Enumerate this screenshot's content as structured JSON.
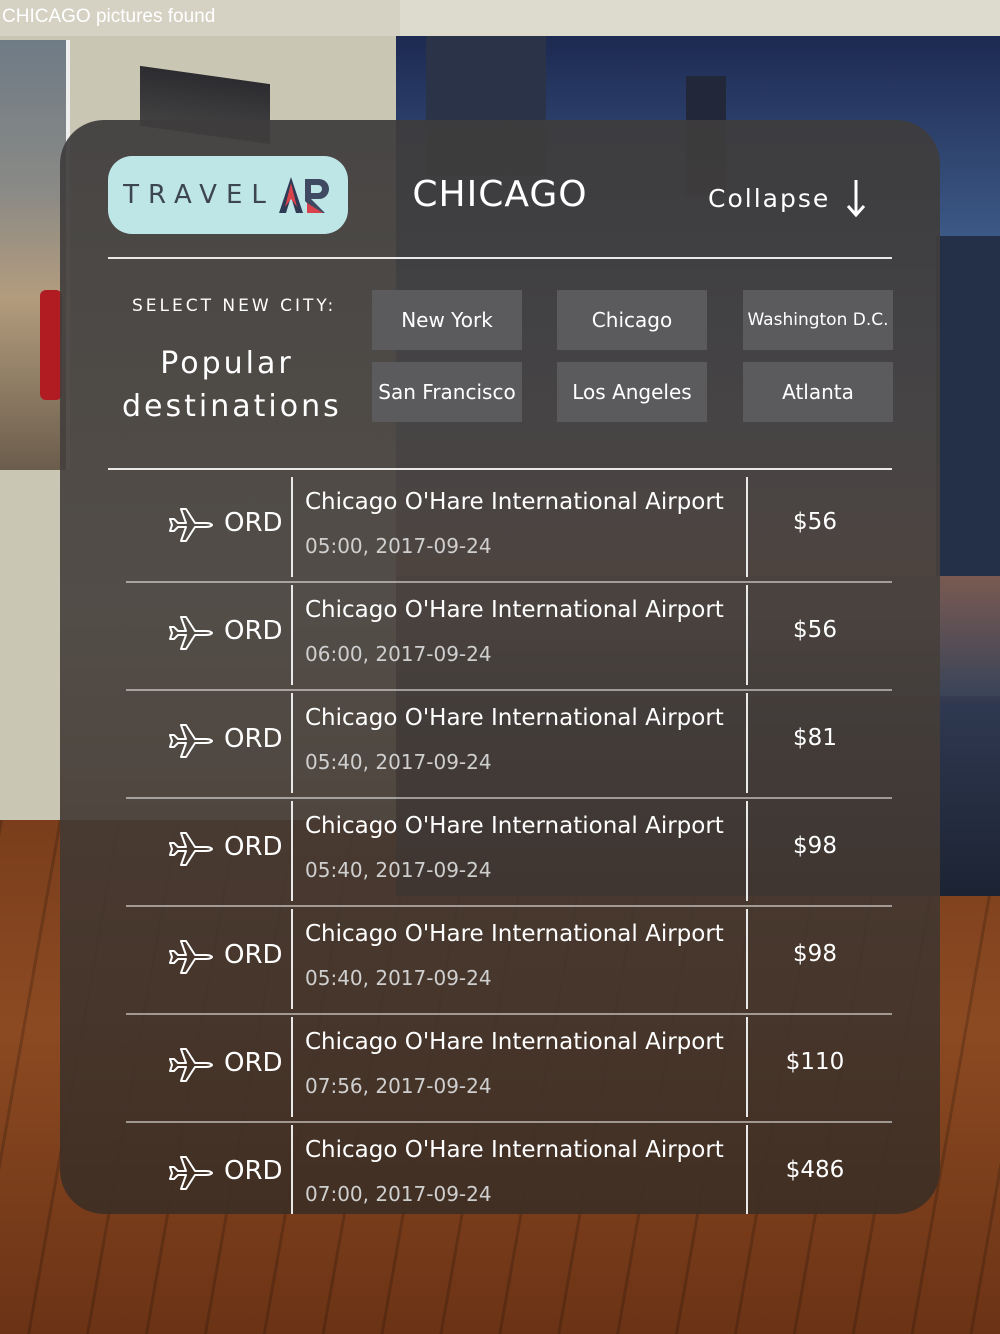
{
  "status": {
    "text": "CHICAGO pictures found"
  },
  "header": {
    "logo_text": "TRAVEL",
    "city_title": "CHICAGO",
    "collapse_label": "Collapse",
    "collapse_icon": "arrow-down-icon"
  },
  "selector": {
    "label": "SELECT NEW CITY:",
    "popular_line1": "Popular",
    "popular_line2": "destinations",
    "cities": [
      "New York",
      "Chicago",
      "Washington D.C.",
      "San Francisco",
      "Los Angeles",
      "Atlanta"
    ]
  },
  "flights": [
    {
      "icon": "airplane-icon",
      "code": "ORD",
      "airport": "Chicago O'Hare International Airport",
      "datetime": "05:00, 2017-09-24",
      "price": "$56"
    },
    {
      "icon": "airplane-icon",
      "code": "ORD",
      "airport": "Chicago O'Hare International Airport",
      "datetime": "06:00, 2017-09-24",
      "price": "$56"
    },
    {
      "icon": "airplane-icon",
      "code": "ORD",
      "airport": "Chicago O'Hare International Airport",
      "datetime": "05:40, 2017-09-24",
      "price": "$81"
    },
    {
      "icon": "airplane-icon",
      "code": "ORD",
      "airport": "Chicago O'Hare International Airport",
      "datetime": "05:40, 2017-09-24",
      "price": "$98"
    },
    {
      "icon": "airplane-icon",
      "code": "ORD",
      "airport": "Chicago O'Hare International Airport",
      "datetime": "05:40, 2017-09-24",
      "price": "$98"
    },
    {
      "icon": "airplane-icon",
      "code": "ORD",
      "airport": "Chicago O'Hare International Airport",
      "datetime": "07:56, 2017-09-24",
      "price": "$110"
    },
    {
      "icon": "airplane-icon",
      "code": "ORD",
      "airport": "Chicago O'Hare International Airport",
      "datetime": "07:00, 2017-09-24",
      "price": "$486"
    }
  ],
  "colors": {
    "logo_bg": "#bfe6e6",
    "city_button_bg": "#5b5a5c",
    "panel_bg": "#3e3c3c",
    "logo_accent_red": "#d9434c",
    "logo_accent_navy": "#2f3a55"
  }
}
